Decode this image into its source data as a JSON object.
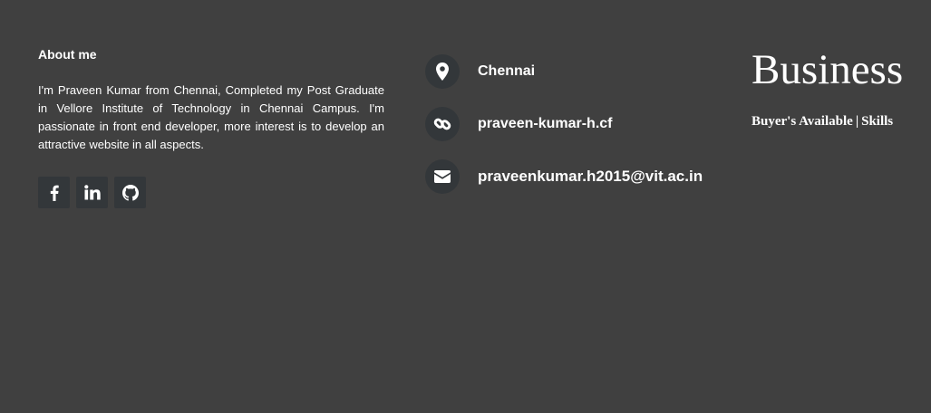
{
  "about": {
    "title": "About me",
    "text": "I'm Praveen Kumar from Chennai, Completed my Post Graduate in Vellore Institute of Technology in Chennai Campus. I'm passionate in front end developer, more interest is to develop an attractive website in all aspects."
  },
  "social": [
    {
      "name": "facebook",
      "icon": "facebook-icon"
    },
    {
      "name": "linkedin",
      "icon": "linkedin-icon"
    },
    {
      "name": "github",
      "icon": "github-icon"
    }
  ],
  "contact": {
    "location": "Chennai",
    "website": "praveen-kumar-h.cf",
    "email": "praveenkumar.h2015@vit.ac.in"
  },
  "business": {
    "title": "Business",
    "buyers": "Buyer's Available",
    "separator": "|",
    "skills": "Skills"
  },
  "colors": {
    "background": "#404040",
    "icon_bg": "#33373a",
    "text": "#ffffff"
  }
}
